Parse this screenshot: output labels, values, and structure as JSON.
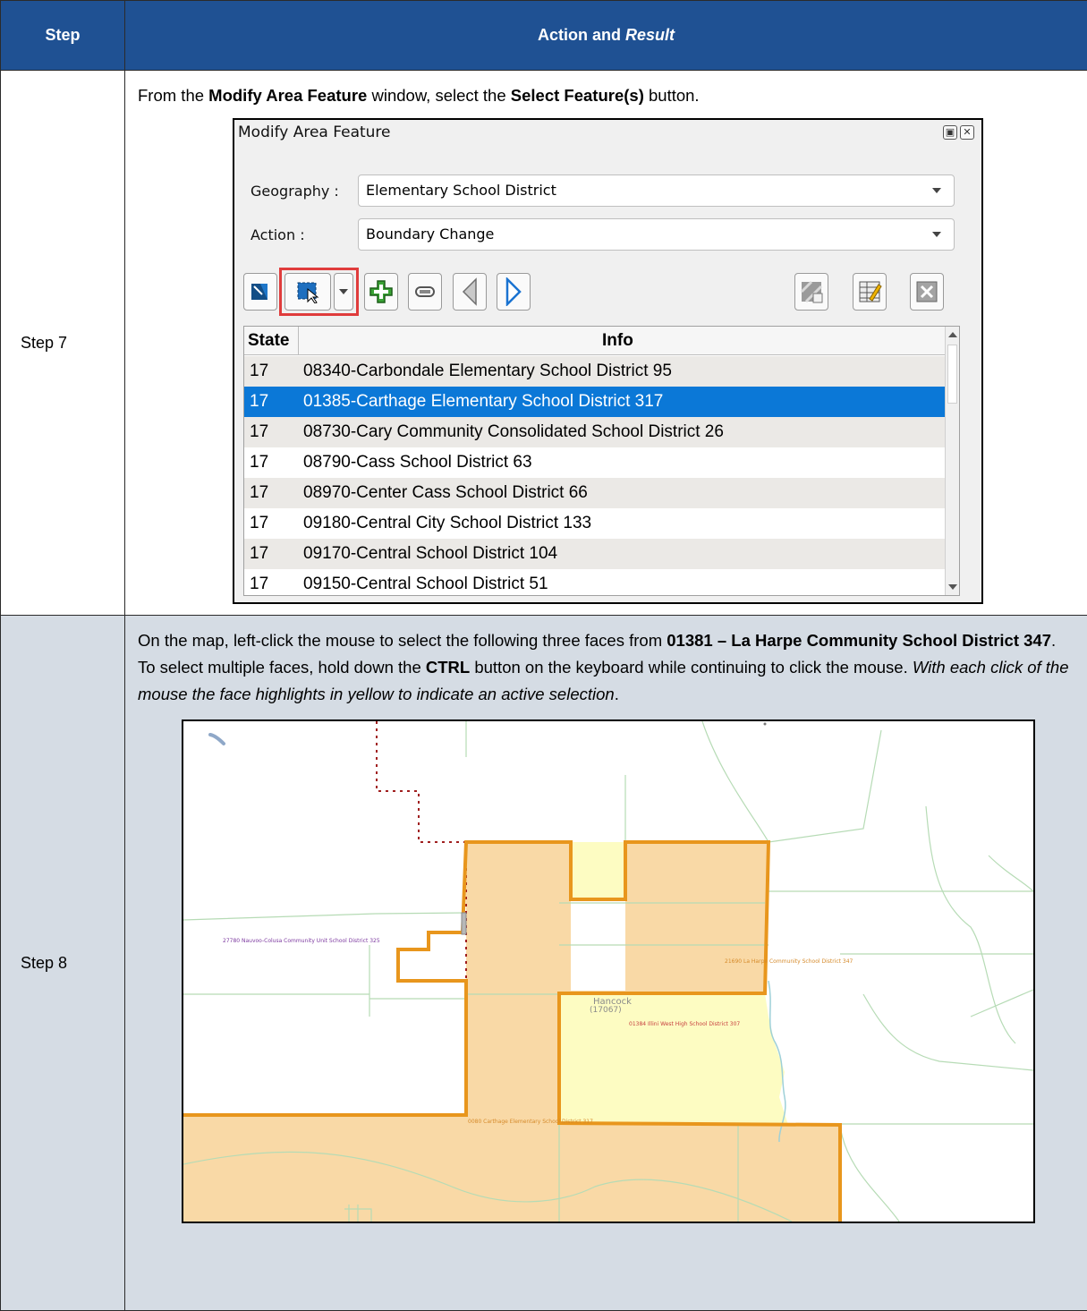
{
  "table": {
    "header_step": "Step",
    "header_action": "Action and",
    "header_result": "Result"
  },
  "step7": {
    "label": "Step 7",
    "instr_1": "From the ",
    "instr_2": "Modify Area Feature",
    "instr_3": " window, select the ",
    "instr_4": "Select Feature(s)",
    "instr_5": " button.",
    "dialog": {
      "title": "Modify Area Feature",
      "geography_label": "Geography :",
      "geography_value": "Elementary School District",
      "action_label": "Action :",
      "action_value": "Boundary Change",
      "toolbar_icons": [
        "select-by-polygon-icon",
        "select-features-icon",
        "dropdown-arrow-icon",
        "add-icon",
        "remove-icon",
        "previous-icon",
        "next-icon",
        "split-icon",
        "attributes-icon",
        "cancel-icon"
      ],
      "columns": [
        "State",
        "Info"
      ],
      "rows": [
        {
          "state": "17",
          "info": "08340-Carbondale Elementary School District 95"
        },
        {
          "state": "17",
          "info": "01385-Carthage Elementary School District 317",
          "selected": true
        },
        {
          "state": "17",
          "info": "08730-Cary Community Consolidated School District 26"
        },
        {
          "state": "17",
          "info": "08790-Cass School District 63"
        },
        {
          "state": "17",
          "info": "08970-Center Cass School District 66"
        },
        {
          "state": "17",
          "info": "09180-Central City School District 133"
        },
        {
          "state": "17",
          "info": "09170-Central School District 104"
        },
        {
          "state": "17",
          "info": "09150-Central School District 51"
        }
      ]
    }
  },
  "step8": {
    "label": "Step 8",
    "instr_1": "On the map, left-click the mouse to select the following three faces from ",
    "instr_2": "01381 – La Harpe Community School District 347",
    "instr_3": ". To select multiple faces, hold down the ",
    "instr_4": "CTRL",
    "instr_5": " button on the keyboard while continuing to click the mouse. ",
    "instr_6": "With each click of the mouse the face highlights in yellow to indicate an active selection",
    "instr_7": ".",
    "map": {
      "label_nauvoo": "27780 Nauvoo-Colusa Community Unit School District 325",
      "label_laharpe": "21690 La Harpe Community School District 347",
      "label_county": "Hancock",
      "label_county_code": "(17067)",
      "label_illini": "01384 Illini West High School District 307",
      "label_carthage": "0080 Carthage Elementary School District 317",
      "colors": {
        "selected_fill": "#fdfcc2",
        "district_fill": "#f9d9a6",
        "boundary": "#e8961d",
        "roads": "#b6dbb5"
      }
    }
  }
}
